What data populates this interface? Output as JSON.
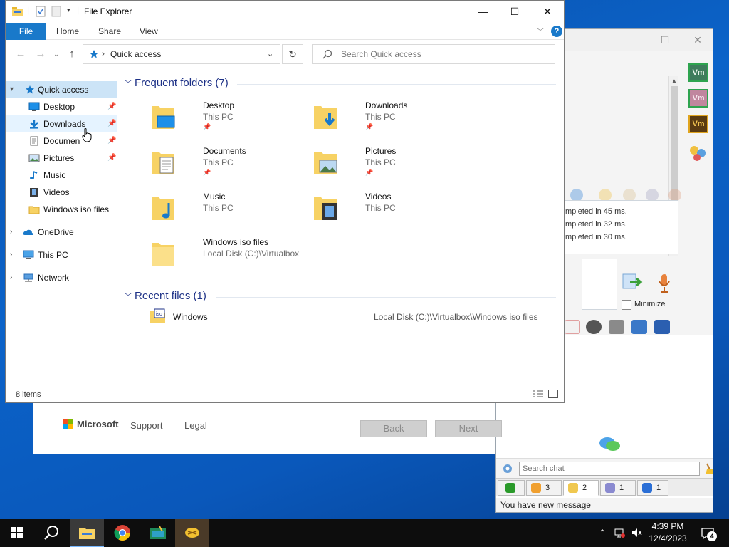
{
  "explorer": {
    "title": "File Explorer",
    "ribbon": {
      "file": "File",
      "home": "Home",
      "share": "Share",
      "view": "View",
      "help": "?"
    },
    "address": "Quick access",
    "search_placeholder": "Search Quick access",
    "sidebar": [
      {
        "label": "Quick access",
        "icon": "star-icon"
      },
      {
        "label": "Desktop",
        "icon": "desktop-icon",
        "pinned": true
      },
      {
        "label": "Downloads",
        "icon": "download-icon",
        "pinned": true
      },
      {
        "label": "Documen",
        "icon": "documents-icon",
        "pinned": true
      },
      {
        "label": "Pictures",
        "icon": "pictures-icon",
        "pinned": true
      },
      {
        "label": "Music",
        "icon": "music-icon"
      },
      {
        "label": "Videos",
        "icon": "videos-icon"
      },
      {
        "label": "Windows iso files",
        "icon": "folder-icon"
      },
      {
        "label": "OneDrive",
        "icon": "cloud-icon"
      },
      {
        "label": "This PC",
        "icon": "computer-icon"
      },
      {
        "label": "Network",
        "icon": "network-icon"
      }
    ],
    "frequent_header": "Frequent folders (7)",
    "frequent": [
      {
        "name": "Desktop",
        "sub": "This PC",
        "pinned": true
      },
      {
        "name": "Downloads",
        "sub": "This PC",
        "pinned": true
      },
      {
        "name": "Documents",
        "sub": "This PC",
        "pinned": true
      },
      {
        "name": "Pictures",
        "sub": "This PC",
        "pinned": true
      },
      {
        "name": "Music",
        "sub": "This PC"
      },
      {
        "name": "Videos",
        "sub": "This PC"
      },
      {
        "name": "Windows iso files",
        "sub": "Local Disk (C:)\\Virtualbox"
      }
    ],
    "recent_header": "Recent files (1)",
    "recent": [
      {
        "name": "Windows",
        "path": "Local Disk (C:)\\Virtualbox\\Windows iso files"
      }
    ],
    "status": "8 items"
  },
  "setup": {
    "brand": "Microsoft",
    "support": "Support",
    "legal": "Legal",
    "back": "Back",
    "next": "Next"
  },
  "chat": {
    "log": [
      "mpleted in 45 ms.",
      "mpleted in 32 ms.",
      "mpleted in 30 ms."
    ],
    "vm_badges": [
      "Vm",
      "Vm",
      "Vm"
    ],
    "minimize": "Minimize",
    "search_placeholder": "Search chat",
    "tabs": [
      "3",
      "2",
      "1",
      "1"
    ],
    "status": "You have new message"
  },
  "taskbar": {
    "time": "4:39 PM",
    "date": "12/4/2023",
    "notifications": "4"
  },
  "colors": {
    "accent": "#1979ca",
    "folder": "#f7d264",
    "taskbar": "#0d0d0d"
  }
}
